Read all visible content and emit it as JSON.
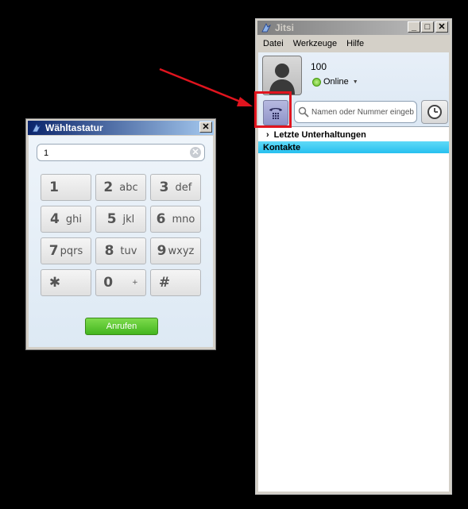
{
  "dialpad_window": {
    "title": "Wähltastatur",
    "number_value": "1",
    "keys": [
      {
        "digit": "1",
        "letters": ""
      },
      {
        "digit": "2",
        "letters": "abc"
      },
      {
        "digit": "3",
        "letters": "def"
      },
      {
        "digit": "4",
        "letters": "ghi"
      },
      {
        "digit": "5",
        "letters": "jkl"
      },
      {
        "digit": "6",
        "letters": "mno"
      },
      {
        "digit": "7",
        "letters": "pqrs"
      },
      {
        "digit": "8",
        "letters": "tuv"
      },
      {
        "digit": "9",
        "letters": "wxyz"
      },
      {
        "digit": "✱",
        "letters": ""
      },
      {
        "digit": "0",
        "letters": "+"
      },
      {
        "digit": "#",
        "letters": ""
      }
    ],
    "call_label": "Anrufen"
  },
  "main_window": {
    "title": "Jitsi",
    "menu": [
      "Datei",
      "Werkzeuge",
      "Hilfe"
    ],
    "account_name": "100",
    "status": "Online",
    "search_placeholder": "Namen oder Nummer eingeb",
    "groups": {
      "recent": "Letzte Unterhaltungen",
      "contacts": "Kontakte"
    }
  },
  "colors": {
    "highlight": "#e0141e",
    "contacts_bar": "#27c0ef",
    "call_button": "#43b51f",
    "status_online": "#5bb51b"
  },
  "icons": [
    "phone-keypad-icon",
    "search-icon",
    "clock-icon",
    "avatar-placeholder",
    "clear-icon",
    "jitsi-app-icon"
  ]
}
